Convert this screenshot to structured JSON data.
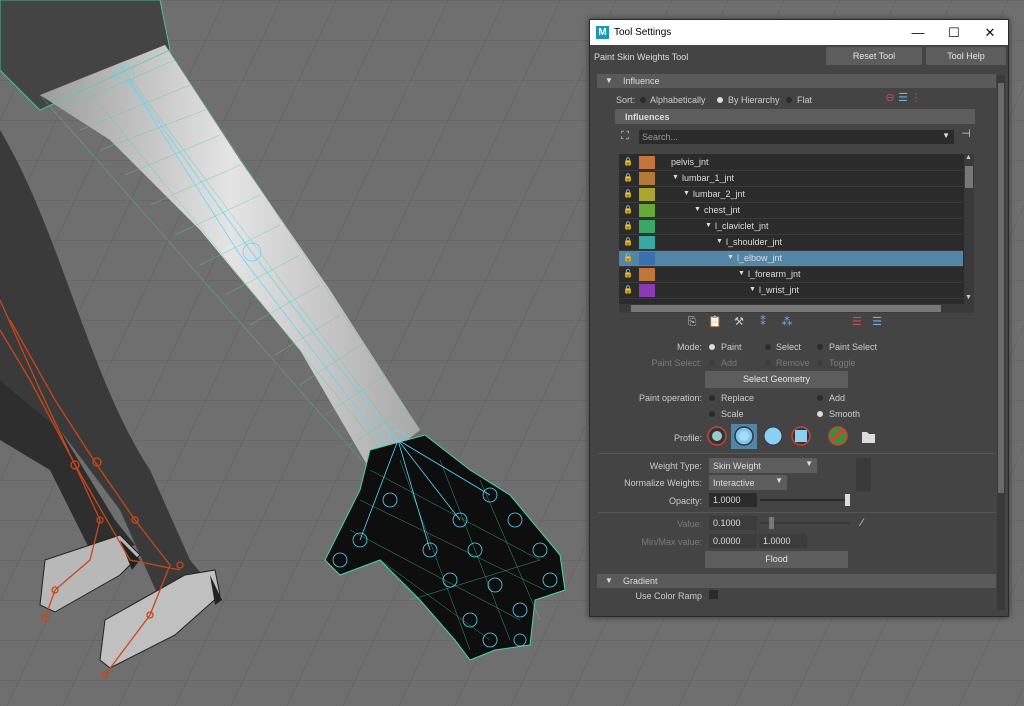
{
  "window": {
    "title": "Tool Settings",
    "tool_name": "Paint Skin Weights Tool",
    "reset_label": "Reset Tool",
    "help_label": "Tool Help",
    "minimize_glyph": "—",
    "maximize_glyph": "☐",
    "close_glyph": "✕",
    "logo_letter": "M"
  },
  "influence": {
    "header": "Influence",
    "sort_label": "Sort:",
    "sort_options": [
      "Alphabetically",
      "By Hierarchy",
      "Flat"
    ],
    "sort_selected": "By Hierarchy",
    "influences_header": "Influences",
    "search_placeholder": "Search...",
    "rows": [
      {
        "name": "pelvis_jnt",
        "color": "#c2763b",
        "locked": true,
        "selected": false
      },
      {
        "name": "lumbar_1_jnt",
        "color": "#b3783a",
        "locked": true,
        "selected": false
      },
      {
        "name": "lumbar_2_jnt",
        "color": "#a8a831",
        "locked": true,
        "selected": false
      },
      {
        "name": "chest_jnt",
        "color": "#68a83a",
        "locked": true,
        "selected": false
      },
      {
        "name": "l_claviclet_jnt",
        "color": "#3aa864",
        "locked": true,
        "selected": false
      },
      {
        "name": "l_shoulder_jnt",
        "color": "#3aa8a2",
        "locked": true,
        "selected": false
      },
      {
        "name": "l_elbow_jnt",
        "color": "#3a6fb0",
        "locked": false,
        "selected": true
      },
      {
        "name": "l_forearm_jnt",
        "color": "#c2763b",
        "locked": false,
        "selected": false
      },
      {
        "name": "l_wrist_jnt",
        "color": "#8a3ab3",
        "locked": true,
        "selected": false
      }
    ]
  },
  "mode": {
    "label": "Mode:",
    "options": [
      "Paint",
      "Select",
      "Paint Select"
    ],
    "selected": "Paint",
    "paint_select_label": "Paint Select:",
    "paint_select_options": [
      "Add",
      "Remove",
      "Toggle"
    ],
    "select_geometry_label": "Select Geometry"
  },
  "paint_operation": {
    "label": "Paint operation:",
    "options": [
      "Replace",
      "Add",
      "Scale",
      "Smooth"
    ],
    "selected": "Smooth"
  },
  "profile": {
    "label": "Profile:"
  },
  "weights": {
    "weight_type_label": "Weight Type:",
    "weight_type_value": "Skin Weight",
    "normalize_label": "Normalize Weights:",
    "normalize_value": "Interactive",
    "opacity_label": "Opacity:",
    "opacity_value": "1.0000",
    "opacity_level": 1.0,
    "value_label": "Value:",
    "value_value": "0.1000",
    "value_level": 0.1,
    "minmax_label": "Min/Max value:",
    "min_value": "0.0000",
    "max_value": "1.0000",
    "flood_label": "Flood"
  },
  "gradient": {
    "header": "Gradient",
    "use_color_ramp_label": "Use Color Ramp"
  },
  "colors": {
    "panel": "#444444",
    "selection": "#5285a6",
    "lock": "#c9a227",
    "wire_green": "#49d5a0",
    "joint_blue": "#5ad6ff",
    "skeleton_red": "#c9471c"
  }
}
